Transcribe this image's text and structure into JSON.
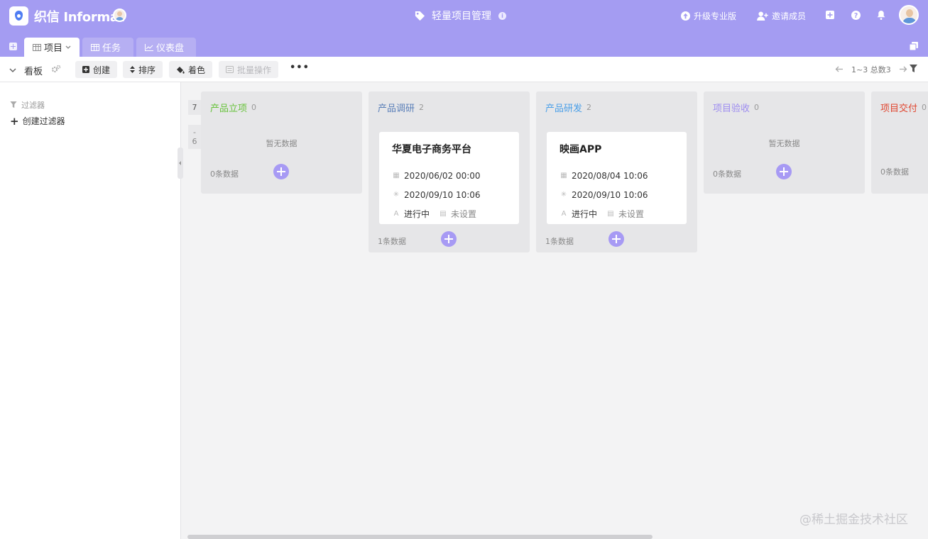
{
  "header": {
    "logo_text": "织信 Informat",
    "app_title": "轻量项目管理",
    "upgrade_label": "升级专业版",
    "invite_label": "邀请成员",
    "accent_color": "#a49cf2"
  },
  "tabs": [
    {
      "label": "项目",
      "active": true
    },
    {
      "label": "任务",
      "active": false
    },
    {
      "label": "仪表盘",
      "active": false
    }
  ],
  "toolbar": {
    "view_title": "看板",
    "create_label": "创建",
    "sort_label": "排序",
    "color_label": "着色",
    "batch_label": "批量操作",
    "more_label": "•••",
    "pager_text": "1~3 总数3"
  },
  "sidebar": {
    "filter_heading": "过滤器",
    "create_filter_label": "创建过滤器"
  },
  "pager_chips": {
    "top": "7",
    "bottom": "-\n6"
  },
  "columns": [
    {
      "title": "产品立项",
      "count": "0",
      "color": "#67c23a",
      "empty_text": "暂无数据",
      "foot": "0条数据"
    },
    {
      "title": "产品调研",
      "count": "2",
      "color": "#5a7fb8",
      "foot": "1条数据",
      "card": {
        "title": "华夏电子商务平台",
        "start": "2020/06/02 00:00",
        "end": "2020/09/10 10:06",
        "status": "进行中",
        "extra": "未设置"
      }
    },
    {
      "title": "产品研发",
      "count": "2",
      "color": "#4a9fe8",
      "foot": "1条数据",
      "card": {
        "title": "映画APP",
        "start": "2020/08/04 10:06",
        "end": "2020/09/10 10:06",
        "status": "进行中",
        "extra": "未设置"
      }
    },
    {
      "title": "项目验收",
      "count": "0",
      "color": "#9d8cf0",
      "empty_text": "暂无数据",
      "foot": "0条数据"
    },
    {
      "title": "项目交付",
      "count": "0",
      "color": "#e0452f",
      "foot": "0条数据"
    }
  ],
  "watermark": "@稀土掘金技术社区"
}
